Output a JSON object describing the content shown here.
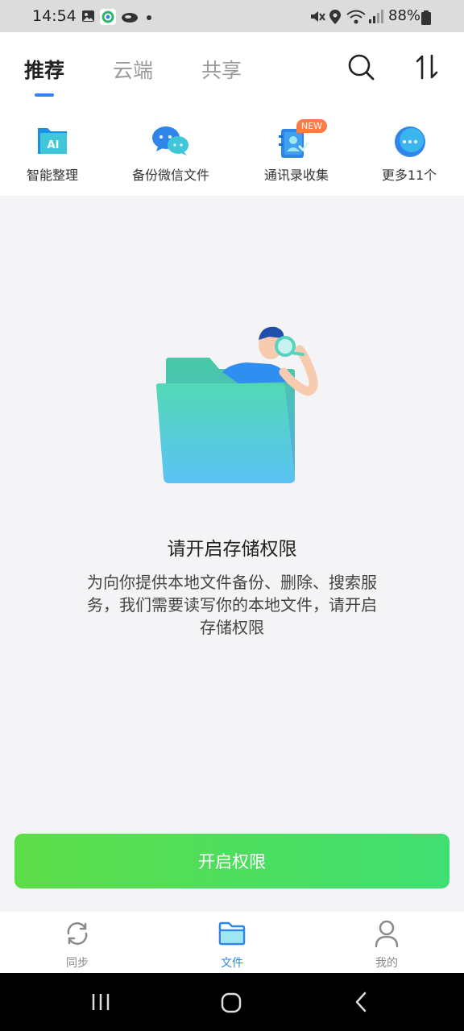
{
  "status": {
    "time": "14:54",
    "battery": "88%"
  },
  "tabs": [
    {
      "label": "推荐",
      "active": true
    },
    {
      "label": "云端",
      "active": false
    },
    {
      "label": "共享",
      "active": false
    }
  ],
  "header_icons": [
    "search-icon",
    "sort-icon"
  ],
  "quick_actions": [
    {
      "label": "智能整理",
      "icon": "ai-folder-icon",
      "badge": ""
    },
    {
      "label": "备份微信文件",
      "icon": "wechat-icon",
      "badge": ""
    },
    {
      "label": "通讯录收集",
      "icon": "contacts-book-icon",
      "badge": "NEW"
    },
    {
      "label": "更多11个",
      "icon": "more-icon",
      "badge": ""
    }
  ],
  "permission": {
    "title": "请开启存储权限",
    "description": "为向你提供本地文件备份、删除、搜索服务，我们需要读写你的本地文件，请开启存储权限",
    "button_label": "开启权限"
  },
  "bottom_nav": [
    {
      "label": "同步",
      "icon": "sync-icon",
      "active": false
    },
    {
      "label": "文件",
      "icon": "folder-icon",
      "active": true
    },
    {
      "label": "我的",
      "icon": "profile-icon",
      "active": false
    }
  ],
  "colors": {
    "accent": "#2f86ea",
    "button_start": "#5ddd48",
    "button_end": "#3fdf72",
    "badge": "#ff7a45"
  }
}
